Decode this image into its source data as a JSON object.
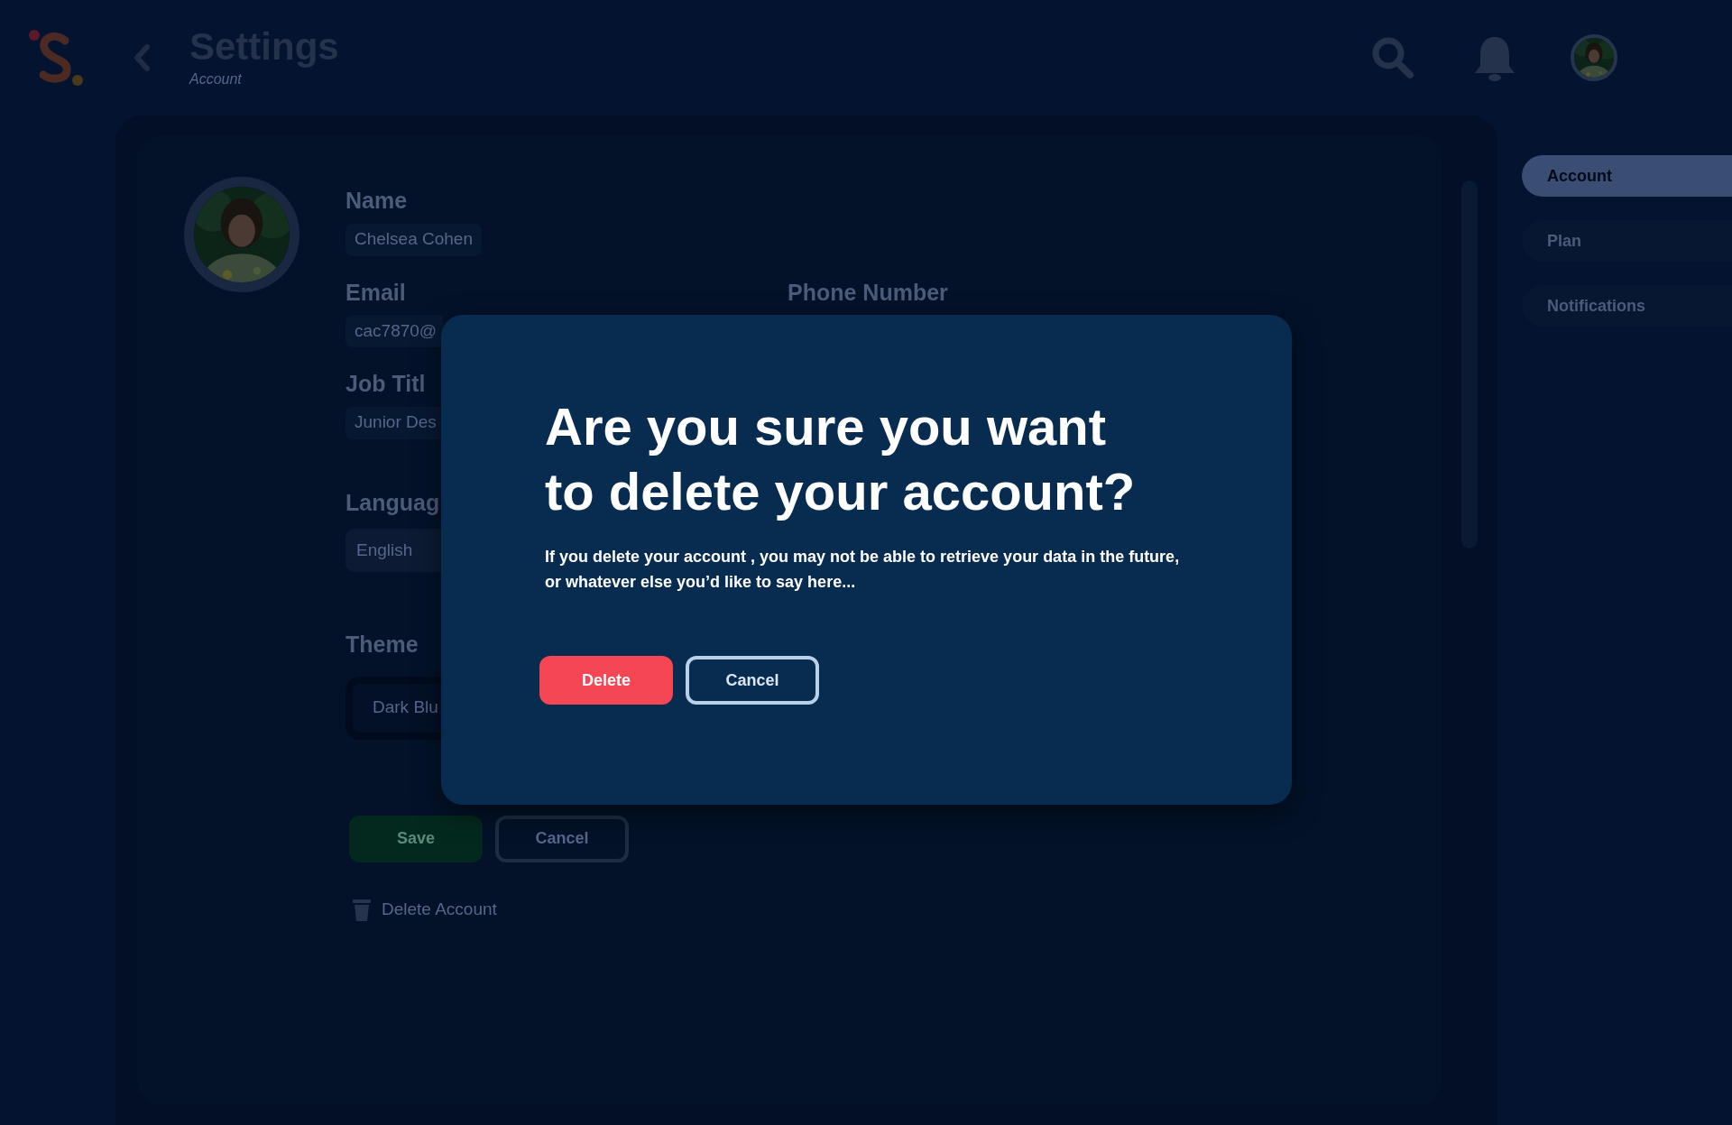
{
  "header": {
    "title": "Settings",
    "subtitle": "Account"
  },
  "form": {
    "name": {
      "label": "Name",
      "value": "Chelsea Cohen"
    },
    "email": {
      "label": "Email",
      "value": "cac7870@"
    },
    "phone": {
      "label": "Phone Number"
    },
    "job_title": {
      "label": "Job Titl",
      "value": "Junior Des"
    },
    "language": {
      "label": "Languag",
      "value": "English"
    },
    "theme": {
      "label": "Theme",
      "value": "Dark Blu"
    },
    "buttons": [
      {
        "label": "Save",
        "kind": "primary"
      },
      {
        "label": "Cancel",
        "kind": "outline"
      }
    ],
    "delete_link": "Delete Account"
  },
  "nav": [
    {
      "label": "Account",
      "selected": true
    },
    {
      "label": "Plan",
      "selected": false
    },
    {
      "label": "Notifications",
      "selected": false
    }
  ],
  "dialog": {
    "title_lines": [
      "Are you sure you want",
      "to delete your account?"
    ],
    "message": "If you delete your account , you may not be able to retrieve your data in the future, or whatever else you’d like to say here...",
    "buttons": [
      {
        "label": "Delete",
        "kind": "danger"
      },
      {
        "label": "Cancel",
        "kind": "outline"
      }
    ]
  }
}
